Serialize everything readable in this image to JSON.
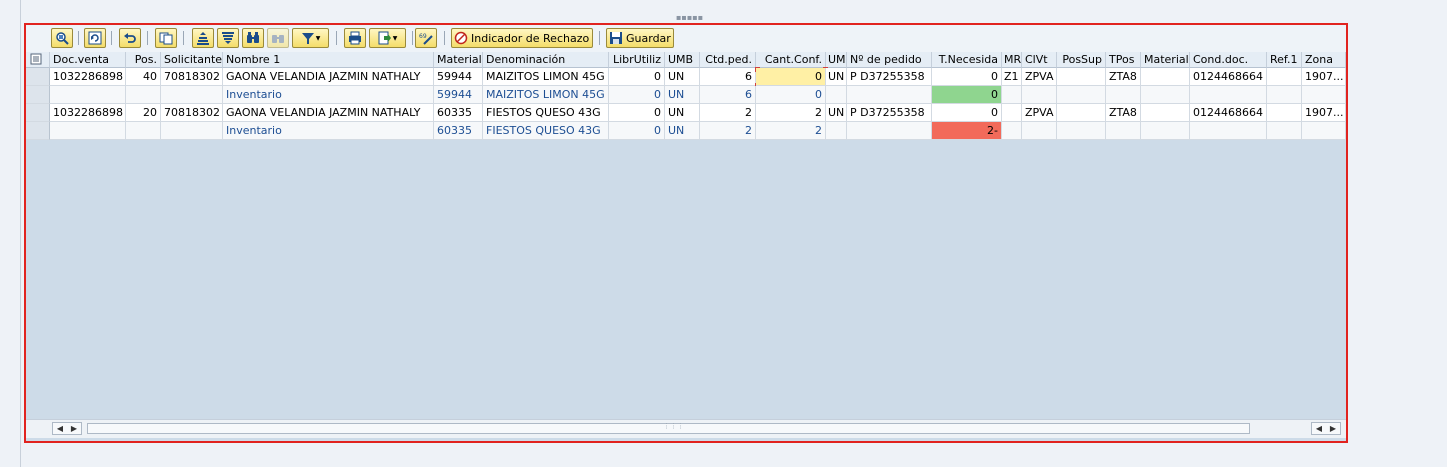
{
  "toolbar": {
    "rejection_label": "Indicador de Rechazo",
    "save_label": "Guardar"
  },
  "grid": {
    "headers": {
      "doc_venta": "Doc.venta",
      "pos": "Pos.",
      "solicitante": "Solicitante",
      "nombre1": "Nombre 1",
      "material": "Material",
      "denominacion": "Denominación",
      "librutiliz": "LibrUtiliz",
      "umb": "UMB",
      "ctd_ped": "Ctd.ped.",
      "cant_conf": "Cant.Conf.",
      "um": "UM",
      "nro_pedido": "Nº de pedido",
      "t_necesida": "T.Necesida",
      "mr": "MR",
      "clvt": "ClVt",
      "possup": "PosSup",
      "tpos": "TPos",
      "material2": "Material",
      "cond_doc": "Cond.doc.",
      "ref1": "Ref.1",
      "zona": "Zona"
    },
    "rows": [
      {
        "doc_venta": "1032286898",
        "pos": "40",
        "solicitante": "70818302",
        "nombre1": "GAONA VELANDIA JAZMIN NATHALY",
        "material": "59944",
        "denominacion": "MAIZITOS LIMON 45G",
        "librutiliz": "0",
        "umb": "UN",
        "ctd_ped": "6",
        "cant_conf": "0",
        "um": "UN",
        "nro_pedido": "P D37255358",
        "t_necesida": "0",
        "mr": "Z1",
        "clvt": "ZPVA",
        "possup": "",
        "tpos": "ZTA8",
        "material2": "",
        "cond_doc": "0124468664",
        "ref1": "",
        "zona": "1907..."
      },
      {
        "doc_venta": "",
        "pos": "",
        "solicitante": "",
        "nombre1": "Inventario",
        "material": "59944",
        "denominacion": "MAIZITOS LIMON 45G",
        "librutiliz": "0",
        "umb": "UN",
        "ctd_ped": "6",
        "cant_conf": "0",
        "um": "",
        "nro_pedido": "",
        "t_necesida": "0",
        "mr": "",
        "clvt": "",
        "possup": "",
        "tpos": "",
        "material2": "",
        "cond_doc": "",
        "ref1": "",
        "zona": ""
      },
      {
        "doc_venta": "1032286898",
        "pos": "20",
        "solicitante": "70818302",
        "nombre1": "GAONA VELANDIA JAZMIN NATHALY",
        "material": "60335",
        "denominacion": "FIESTOS QUESO 43G",
        "librutiliz": "0",
        "umb": "UN",
        "ctd_ped": "2",
        "cant_conf": "2",
        "um": "UN",
        "nro_pedido": "P D37255358",
        "t_necesida": "0",
        "mr": "",
        "clvt": "ZPVA",
        "possup": "",
        "tpos": "ZTA8",
        "material2": "",
        "cond_doc": "0124468664",
        "ref1": "",
        "zona": "1907..."
      },
      {
        "doc_venta": "",
        "pos": "",
        "solicitante": "",
        "nombre1": "Inventario",
        "material": "60335",
        "denominacion": "FIESTOS QUESO 43G",
        "librutiliz": "0",
        "umb": "UN",
        "ctd_ped": "2",
        "cant_conf": "2",
        "um": "",
        "nro_pedido": "",
        "t_necesida": "2-",
        "mr": "",
        "clvt": "",
        "possup": "",
        "tpos": "",
        "material2": "",
        "cond_doc": "",
        "ref1": "",
        "zona": ""
      }
    ]
  },
  "status_colors": {
    "ok": "#8fd58f",
    "shortage": "#f26a5a",
    "edit": "#fff0a5",
    "frame": "#e1231f"
  }
}
